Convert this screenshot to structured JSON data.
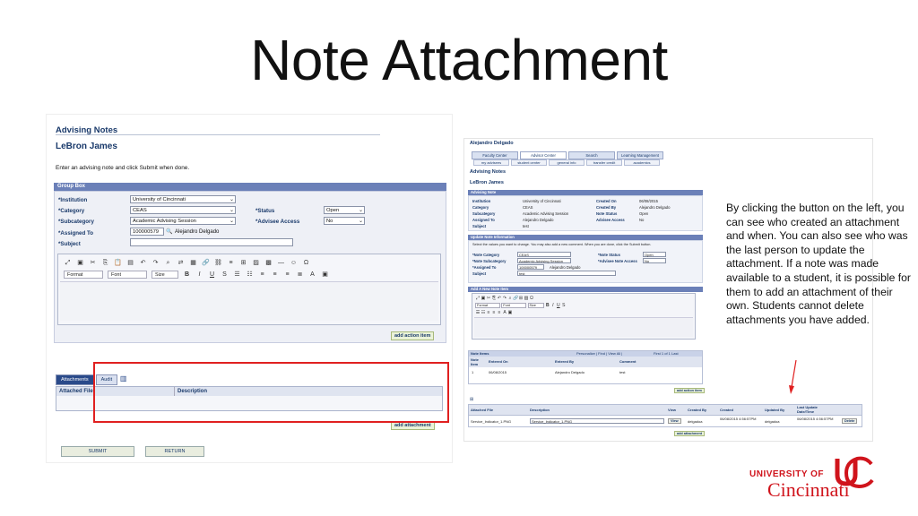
{
  "slide": {
    "title": "Note Attachment",
    "callout": "By clicking the button on the left, you can see who created an attachment and when. You can also see who was the last person to update the attachment. If a note was made available to a student, it is possible for them to add an attachment of their own. Students cannot delete attachments you have added."
  },
  "left": {
    "heading": "Advising Notes",
    "student": "LeBron James",
    "instruction": "Enter an advising note and click Submit when done.",
    "group_box": "Group Box",
    "labels": {
      "institution": "*Institution",
      "category": "*Category",
      "subcategory": "*Subcategory",
      "assigned_to": "*Assigned To",
      "subject": "*Subject",
      "status": "*Status",
      "advisee_access": "*Advisee Access"
    },
    "values": {
      "institution": "University of Cincinnati",
      "category": "CEAS",
      "subcategory": "Academic Advising Session",
      "assigned_id": "100000579",
      "assigned_name": "Alejandro Delgado",
      "status": "Open",
      "advisee_access": "No"
    },
    "editor": {
      "format": "Format",
      "font": "Font",
      "size": "Size"
    },
    "add_action_item": "add action item",
    "tabs": [
      "Attachments",
      "Audit"
    ],
    "attach_cols": [
      "Attached File",
      "Description"
    ],
    "add_attachment": "add attachment",
    "submit": "SUBMIT",
    "return": "RETURN"
  },
  "right": {
    "user": "Alejandro Delgado",
    "top_tabs": [
      "Faculty Center",
      "Advisor Center",
      "Search",
      "Learning Management"
    ],
    "sub_tabs": [
      "my advisees",
      "student center",
      "general info",
      "transfer credit",
      "academics"
    ],
    "heading": "Advising Notes",
    "student": "LeBron James",
    "note_bar": "Advising Note",
    "note": {
      "institution_l": "Institution",
      "institution_v": "University of Cincinnati",
      "category_l": "Category",
      "category_v": "CEAS",
      "subcategory_l": "Subcategory",
      "subcategory_v": "Academic Advising Session",
      "assigned_l": "Assigned To",
      "assigned_v": "Alejandro Delgado",
      "subject_l": "Subject",
      "subject_v": "test",
      "created_on_l": "Created On",
      "created_on_v": "06/08/2015",
      "created_by_l": "Created By",
      "created_by_v": "Alejandro Delgado",
      "status_l": "Note Status",
      "status_v": "Open",
      "access_l": "Advisee Access",
      "access_v": "No"
    },
    "update_bar": "Update Note Information",
    "update_instr": "Select the values you want to change. You may also add a new comment. When you are done, click the Submit button.",
    "update": {
      "category_l": "*Note Category",
      "category_v": "CEAS",
      "subcat_l": "*Note Subcategory",
      "subcat_v": "Academic Advising Session",
      "assigned_l": "*Assigned To",
      "assigned_id": "100000579",
      "assigned_name": "Alejandro Delgado",
      "subject_l": "Subject",
      "subject_v": "test",
      "status_l": "*Note Status",
      "status_v": "Open",
      "access_l": "*Advisee Note Access",
      "access_v": "No"
    },
    "add_item_bar": "Add A New Note Item",
    "editor": {
      "format": "Format",
      "font": "Font",
      "size": "Size"
    },
    "items_header": "Note Items",
    "items_tools": "Personalize | Find | View All |",
    "items_pager": "First  1 of 1  Last",
    "items_cols": [
      "Note Item",
      "Entered On",
      "Entered By",
      "Comment"
    ],
    "item_row": [
      "1",
      "06/08/2015",
      "Alejandro Delgado",
      "test"
    ],
    "add_action_item": "add action item",
    "att_cols": [
      "Attached File",
      "Description",
      "View",
      "Created By",
      "Created",
      "Updated By",
      "Last Update Date/Time"
    ],
    "att_row": {
      "file": "Service_Indicator_1.PNG",
      "desc": "Service_Indicator_1.PNG",
      "view": "View",
      "created_by": "delgadoa",
      "created": "06/08/2015 4:56:57PM",
      "updated_by": "delgadoa",
      "updated": "06/08/2015 4:56:57PM",
      "delete": "Delete"
    },
    "add_attachment": "add attachment"
  },
  "logo": {
    "line1": "UNIVERSITY OF",
    "line2": "Cincinnati"
  }
}
